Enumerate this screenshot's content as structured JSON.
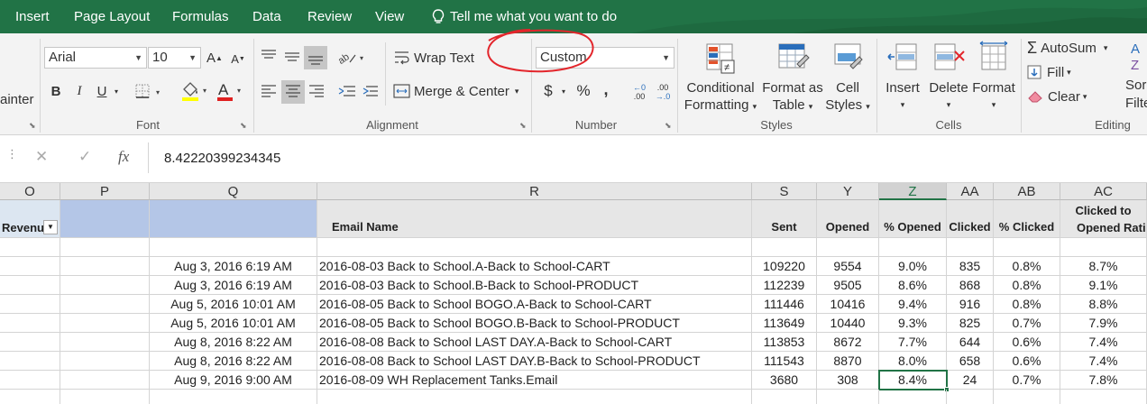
{
  "tabs": [
    "Insert",
    "Page Layout",
    "Formulas",
    "Data",
    "Review",
    "View"
  ],
  "tell_me": "Tell me what you want to do",
  "ribbon": {
    "clipboard_partial": "ainter",
    "font": {
      "name": "Arial",
      "size": "10",
      "group_label": "Font",
      "bold": "B",
      "italic": "I",
      "underline": "U",
      "grow": "A",
      "shrink": "A",
      "color_letter": "A"
    },
    "alignment": {
      "wrap_text": "Wrap Text",
      "merge_center": "Merge & Center",
      "group_label": "Alignment"
    },
    "number": {
      "format": "Custom",
      "currency": "$",
      "percent": "%",
      "comma": ",",
      "inc_decimal": ".00",
      "dec_decimal": ".0",
      "group_label": "Number"
    },
    "styles": {
      "conditional": "Conditional",
      "formatting": "Formatting",
      "format_as": "Format as",
      "table": "Table",
      "cell": "Cell",
      "styles": "Styles",
      "group_label": "Styles"
    },
    "cells": {
      "insert": "Insert",
      "delete": "Delete",
      "format": "Format",
      "group_label": "Cells"
    },
    "editing": {
      "autosum": "AutoSum",
      "fill": "Fill",
      "clear": "Clear",
      "sort_partial_1": "Sor",
      "sort_partial_2": "Filte",
      "group_label": "Editing"
    }
  },
  "formula_bar": {
    "cancel": "✕",
    "enter": "✓",
    "fx": "fx",
    "value": "8.42220399234345"
  },
  "columns": [
    "O",
    "P",
    "Q",
    "R",
    "S",
    "Y",
    "Z",
    "AA",
    "AB",
    "AC"
  ],
  "headers": {
    "O": "Revenu",
    "R": "Email Name",
    "S": "Sent",
    "Y": "Opened",
    "Z": "% Opened",
    "AA": "Clicked",
    "AB": "% Clicked",
    "AC_line1": "Clicked to",
    "AC_line2": "Opened Ratio"
  },
  "rows": [
    {
      "date": "Aug 3, 2016 6:19 AM",
      "name": "2016-08-03 Back to School.A-Back to School-CART",
      "sent": "109220",
      "opened": "9554",
      "pct_opened": "9.0%",
      "clicked": "835",
      "pct_clicked": "0.8%",
      "ratio": "8.7%"
    },
    {
      "date": "Aug 3, 2016 6:19 AM",
      "name": "2016-08-03 Back to School.B-Back to School-PRODUCT",
      "sent": "112239",
      "opened": "9505",
      "pct_opened": "8.6%",
      "clicked": "868",
      "pct_clicked": "0.8%",
      "ratio": "9.1%"
    },
    {
      "date": "Aug 5, 2016 10:01 AM",
      "name": "2016-08-05 Back to School BOGO.A-Back to School-CART",
      "sent": "111446",
      "opened": "10416",
      "pct_opened": "9.4%",
      "clicked": "916",
      "pct_clicked": "0.8%",
      "ratio": "8.8%"
    },
    {
      "date": "Aug 5, 2016 10:01 AM",
      "name": "2016-08-05 Back to School BOGO.B-Back to School-PRODUCT",
      "sent": "113649",
      "opened": "10440",
      "pct_opened": "9.3%",
      "clicked": "825",
      "pct_clicked": "0.7%",
      "ratio": "7.9%"
    },
    {
      "date": "Aug 8, 2016 8:22 AM",
      "name": "2016-08-08 Back to School LAST DAY.A-Back to School-CART",
      "sent": "113853",
      "opened": "8672",
      "pct_opened": "7.7%",
      "clicked": "644",
      "pct_clicked": "0.6%",
      "ratio": "7.4%"
    },
    {
      "date": "Aug 8, 2016 8:22 AM",
      "name": "2016-08-08 Back to School LAST DAY.B-Back to School-PRODUCT",
      "sent": "111543",
      "opened": "8870",
      "pct_opened": "8.0%",
      "clicked": "658",
      "pct_clicked": "0.6%",
      "ratio": "7.4%"
    },
    {
      "date": "Aug 9, 2016 9:00 AM",
      "name": "2016-08-09 WH Replacement Tanks.Email",
      "sent": "3680",
      "opened": "308",
      "pct_opened": "8.4%",
      "clicked": "24",
      "pct_clicked": "0.7%",
      "ratio": "7.8%"
    }
  ],
  "colors": {
    "excel_green": "#217346",
    "annotation_red": "#e3252b",
    "header_blue": "#b4c6e7",
    "header_gray": "#e6e6e6"
  }
}
